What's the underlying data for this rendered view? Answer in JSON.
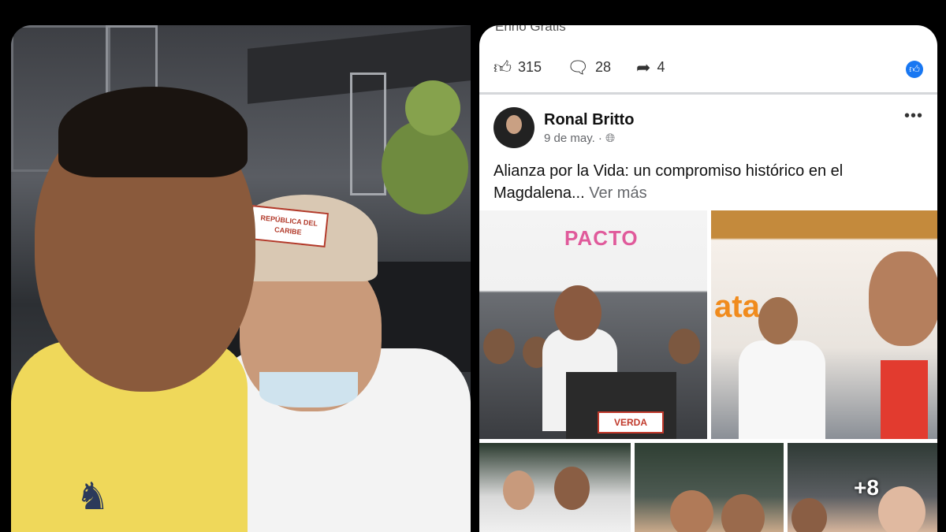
{
  "left_photo": {
    "cap_patch_text": "REPÚBLICA DEL CARIBE"
  },
  "post": {
    "clipped_top_text": "Enno Gratis",
    "reactions": {
      "likes": "315",
      "comments": "28",
      "shares": "4"
    },
    "author": "Ronal Britto",
    "date": "9 de may. ·",
    "text": "Alianza por la Vida: un compromiso histórico en el Magdalena...",
    "see_more": "Ver más",
    "images": {
      "pic1_banner": "PACTO",
      "pic1_podium_sign": "VERDA",
      "pic2_banner": "ata",
      "more_count": "+8"
    }
  },
  "icons": {
    "like": "thumbs-up-icon",
    "comment": "comment-icon",
    "share": "share-icon",
    "facebook": "facebook-like-badge-icon",
    "globe": "globe-icon",
    "more": "more-options-icon"
  },
  "colors": {
    "facebook_blue": "#1877f2",
    "secondary_text": "#65676b"
  }
}
